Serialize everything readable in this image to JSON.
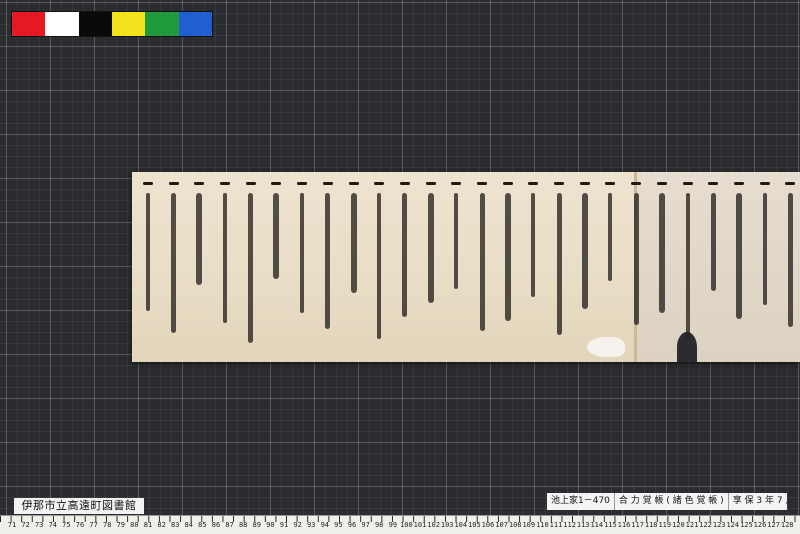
{
  "color_bar": {
    "swatches": [
      "#e51a24",
      "#ffffff",
      "#0a0a0a",
      "#f4e21c",
      "#1f9a3c",
      "#1f5fd1"
    ]
  },
  "document": {
    "columns": 26
  },
  "labels": {
    "library": "伊那市立高遠町図書館",
    "catalog_id": "池上家1－470",
    "catalog_title": "合 力 覚 帳 ( 諸 色 覚 帳 )",
    "catalog_date": "享 保 3 年 7 月"
  },
  "ruler": {
    "numbers": [
      "71",
      "72",
      "73",
      "74",
      "75",
      "76",
      "77",
      "78",
      "79",
      "80",
      "81",
      "82",
      "83",
      "84",
      "85",
      "86",
      "87",
      "88",
      "89",
      "90",
      "91",
      "92",
      "93",
      "94",
      "95",
      "96",
      "97",
      "98",
      "99",
      "100",
      "101",
      "102",
      "103",
      "104",
      "105",
      "106",
      "107",
      "108",
      "109",
      "110",
      "111",
      "112",
      "113",
      "114",
      "115",
      "116",
      "117",
      "118",
      "119",
      "120",
      "121",
      "122",
      "123",
      "124",
      "125",
      "126",
      "127",
      "128"
    ]
  }
}
